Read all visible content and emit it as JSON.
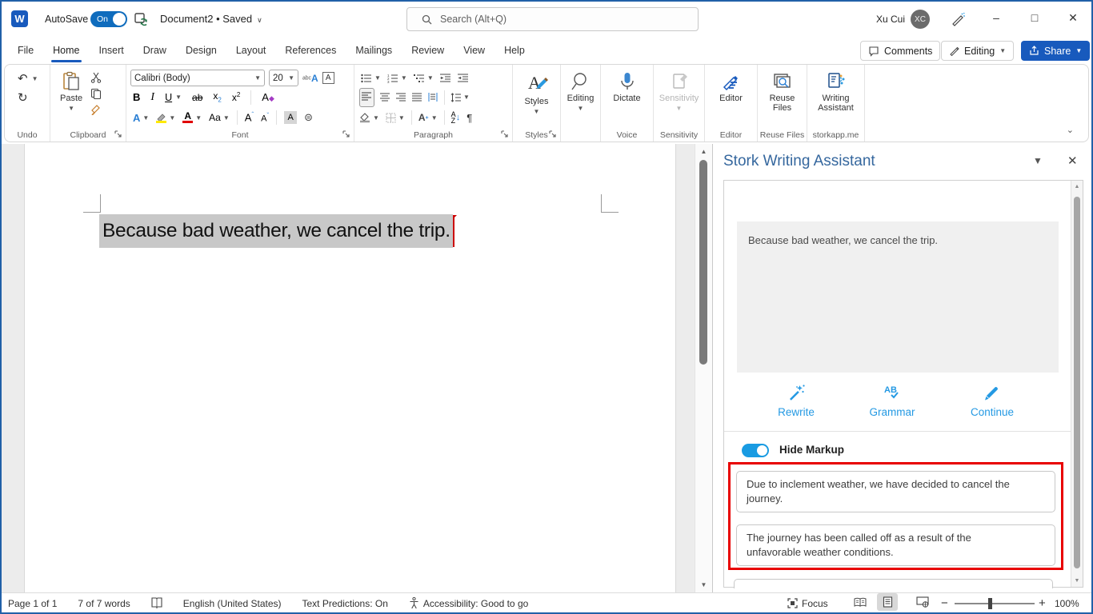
{
  "titlebar": {
    "autosave_label": "AutoSave",
    "autosave_state": "On",
    "doc_title": "Document2",
    "doc_status": "Saved",
    "search_placeholder": "Search (Alt+Q)",
    "user_name": "Xu Cui",
    "user_initials": "XC",
    "minimize": "–",
    "maximize": "□",
    "close": "✕"
  },
  "menu": {
    "tabs": [
      {
        "label": "File"
      },
      {
        "label": "Home"
      },
      {
        "label": "Insert"
      },
      {
        "label": "Draw"
      },
      {
        "label": "Design"
      },
      {
        "label": "Layout"
      },
      {
        "label": "References"
      },
      {
        "label": "Mailings"
      },
      {
        "label": "Review"
      },
      {
        "label": "View"
      },
      {
        "label": "Help"
      }
    ],
    "comments_label": "Comments",
    "editing_label": "Editing",
    "share_label": "Share"
  },
  "ribbon": {
    "font_name": "Calibri (Body)",
    "font_size": "20",
    "paste_label": "Paste",
    "groups": {
      "undo": "Undo",
      "clipboard": "Clipboard",
      "font": "Font",
      "paragraph": "Paragraph",
      "styles": "Styles",
      "voice": "Voice",
      "sensitivity": "Sensitivity",
      "editor": "Editor",
      "reuse_files": "Reuse Files",
      "writing_assistant": "storkapp.me"
    },
    "buttons": {
      "styles": "Styles",
      "editing": "Editing",
      "dictate": "Dictate",
      "sensitivity": "Sensitivity",
      "editor": "Editor",
      "reuse_line1": "Reuse",
      "reuse_line2": "Files",
      "wa_line1": "Writing",
      "wa_line2": "Assistant"
    }
  },
  "document": {
    "text": "Because bad weather, we cancel the trip."
  },
  "panel": {
    "title": "Stork Writing Assistant",
    "input_text": "Because bad weather, we cancel the trip.",
    "actions": [
      {
        "label": "Rewrite"
      },
      {
        "label": "Grammar"
      },
      {
        "label": "Continue"
      }
    ],
    "toggle_label": "Hide Markup",
    "suggestions": [
      "Due to inclement weather, we have decided to cancel the journey.",
      "The journey has been called off as a result of the unfavorable weather conditions."
    ]
  },
  "statusbar": {
    "page": "Page 1 of 1",
    "words": "7 of 7 words",
    "language": "English (United States)",
    "predictions": "Text Predictions: On",
    "accessibility": "Accessibility: Good to go",
    "focus": "Focus",
    "zoom": "100%"
  }
}
